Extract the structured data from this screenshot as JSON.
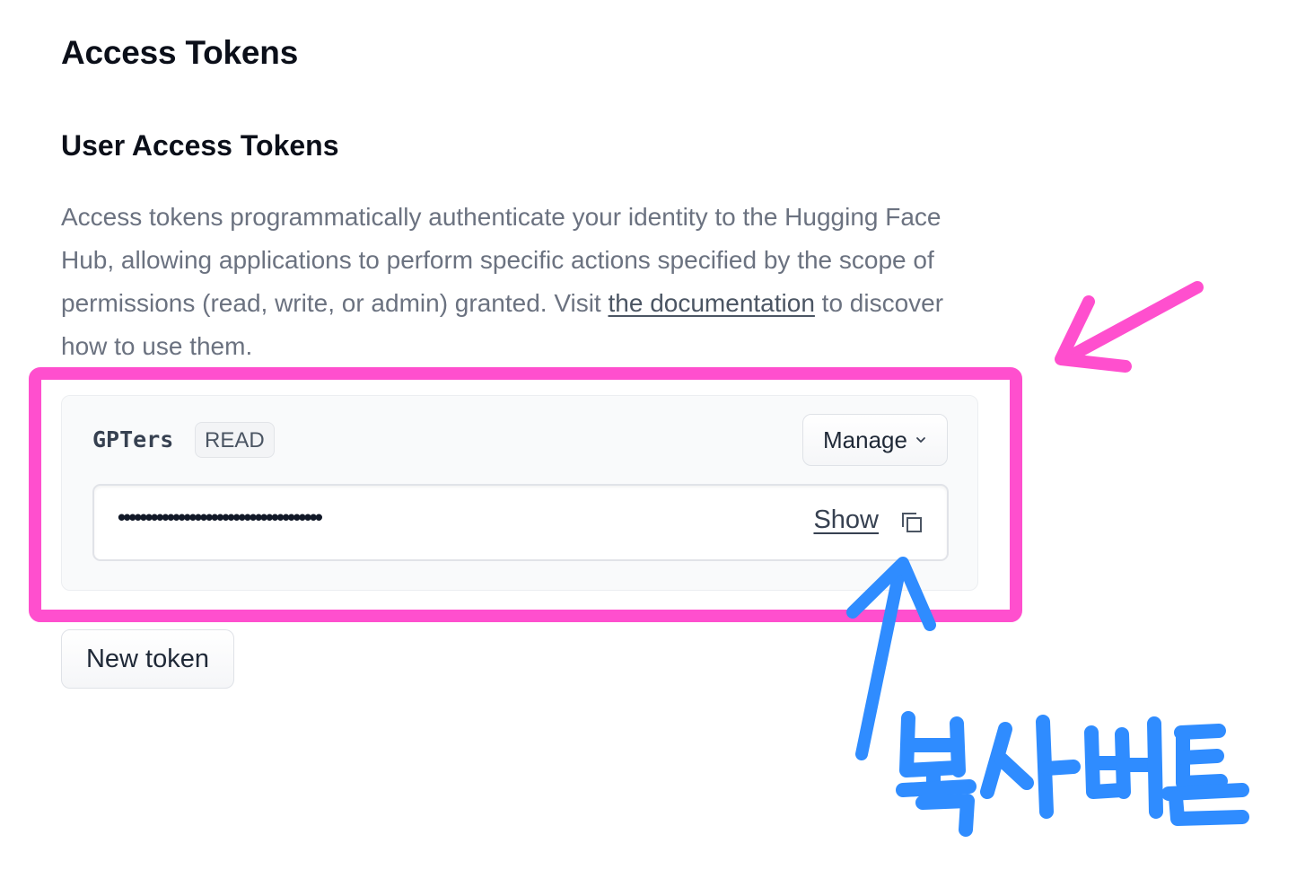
{
  "header": {
    "title": "Access Tokens"
  },
  "section": {
    "title": "User Access Tokens",
    "description_prefix": "Access tokens programmatically authenticate your identity to the Hugging Face Hub, allowing applications to perform specific actions specified by the scope of permissions (read, write, or admin) granted. Visit ",
    "description_link": "the documentation",
    "description_suffix": " to discover how to use them."
  },
  "token": {
    "name": "GPTers",
    "role": "READ",
    "masked_value": "•••••••••••••••••••••••••••••••••••••",
    "show_label": "Show",
    "manage_label": "Manage",
    "copy_icon": "copy-icon"
  },
  "actions": {
    "new_token_label": "New token"
  },
  "annotations": {
    "handwritten_label": "복사버튼",
    "highlight_color": "#ff4fce",
    "pen_color": "#2f8cff"
  }
}
